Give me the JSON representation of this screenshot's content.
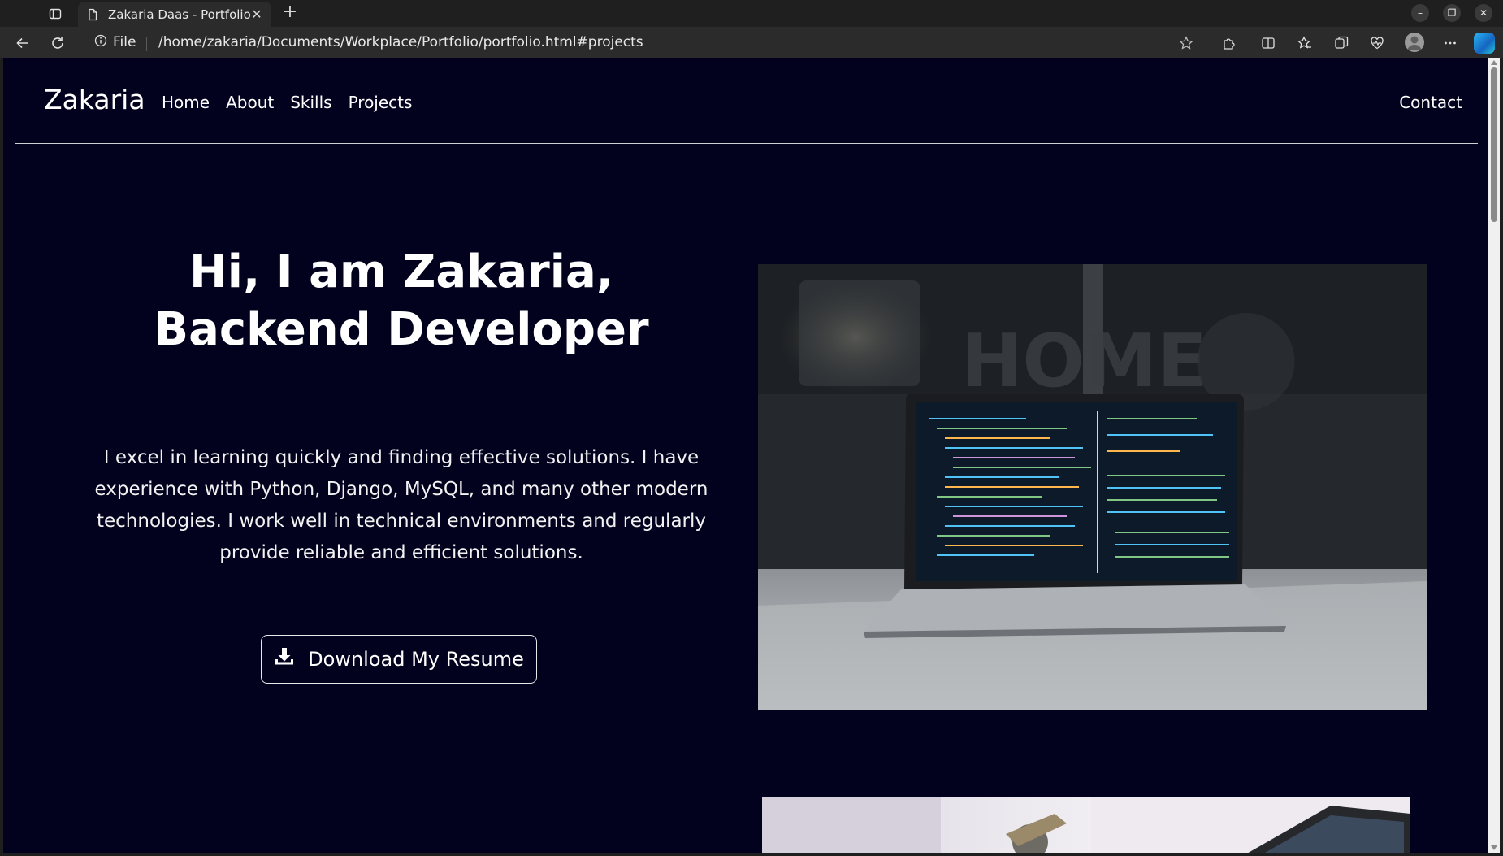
{
  "browser": {
    "tab_title": "Zakaria Daas - Portfolio",
    "url_scheme_label": "File",
    "url": "/home/zakaria/Documents/Workplace/Portfolio/portfolio.html#projects",
    "icons": {
      "workspaces": "workspaces-icon",
      "page": "document-icon",
      "close_tab": "close-icon",
      "new_tab": "plus-icon",
      "back": "back-arrow-icon",
      "reload": "reload-icon",
      "info": "info-icon",
      "favorite": "star-icon",
      "extensions": "puzzle-icon",
      "split": "split-screen-icon",
      "favorites": "favorites-icon",
      "collections": "collections-icon",
      "browser_essentials": "heart-pulse-icon",
      "profile": "profile-icon",
      "more": "more-icon",
      "copilot": "copilot-icon"
    }
  },
  "site": {
    "brand": "Zakaria",
    "nav": [
      "Home",
      "About",
      "Skills",
      "Projects"
    ],
    "contact": "Contact"
  },
  "hero": {
    "title_line1": "Hi, I am Zakaria,",
    "title_line2": "Backend Developer",
    "description": "I excel in learning quickly and finding effective solutions. I have experience with Python, Django, MySQL, and many other modern technologies. I work well in technical environments and regularly provide reliable and efficient solutions.",
    "resume_button": "Download My Resume",
    "resume_icon": "download-icon"
  },
  "colors": {
    "page_background": "#02021e",
    "text": "#ffffff",
    "browser_frame": "#1f1f1f"
  }
}
